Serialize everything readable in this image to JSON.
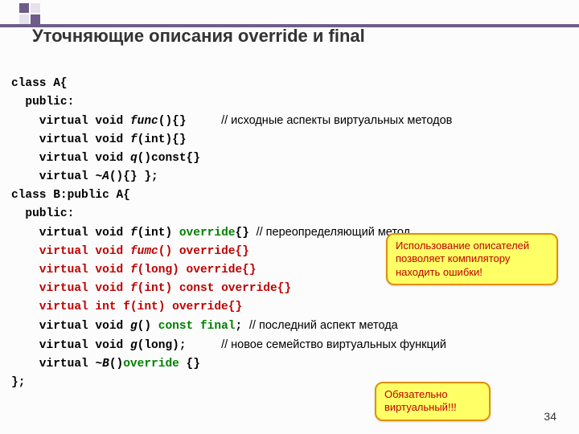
{
  "title": "Уточняющие описания override и final",
  "code": {
    "l01": "class A{",
    "l02": "  public:",
    "l03a": "    virtual void ",
    "l03b": "func",
    "l03c": "(){}     ",
    "l03d": "// исходные аспекты виртуальных методов",
    "l04a": "    virtual void ",
    "l04b": "f",
    "l04c": "(int){}",
    "l05a": "    virtual void ",
    "l05b": "q",
    "l05c": "()const{}",
    "l06a": "    virtual ",
    "l06b": "~A",
    "l06c": "(){} };",
    "l07": "class B:public A{",
    "l08": "  public:",
    "l09a": "    virtual void ",
    "l09b": "f",
    "l09c": "(int) ",
    "l09d": "override",
    "l09e": "{} ",
    "l09f": "// переопределяющий метод",
    "l10a": "    virtual void ",
    "l10b": "fumc",
    "l10c": "() override{}",
    "l11a": "    virtual void ",
    "l11b": "f",
    "l11c": "(",
    "l11d": "long",
    "l11e": ") override{}",
    "l12a": "    virtual void ",
    "l12b": "f",
    "l12c": "(int) ",
    "l12d": "const",
    "l12e": " override{}",
    "l13a": "    virtual ",
    "l13b": "int",
    "l13c": " f(int) override{}",
    "l14a": "    virtual void ",
    "l14b": "g",
    "l14c": "() ",
    "l14d": "const final",
    "l14e": "; ",
    "l14f": "// последний аспект метода",
    "l15a": "    virtual void ",
    "l15b": "g",
    "l15c": "(long);     ",
    "l15d": "// новое семейство виртуальных функций",
    "l16a": "    virtual ",
    "l16b": "~B",
    "l16c": "()",
    "l16d": "override",
    "l16e": " {}",
    "l17": "};"
  },
  "callout1": "Использование описателей позволяет компилятору находить ошибки!",
  "callout2": "Обязательно виртуальный!!!",
  "page_num": "34"
}
